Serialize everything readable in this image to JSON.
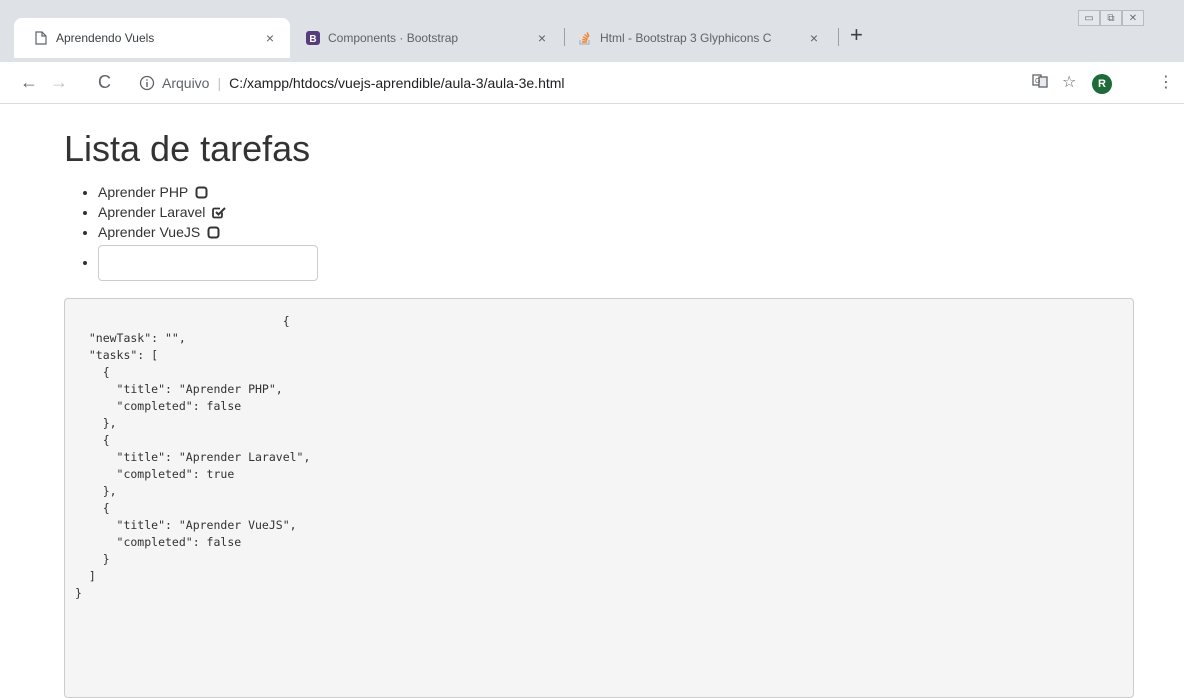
{
  "browser": {
    "tabs": [
      {
        "title": "Aprendendo Vuels",
        "close": "×"
      },
      {
        "title": "Components · Bootstrap",
        "close": "×"
      },
      {
        "title": "Html - Bootstrap 3 Glyphicons C",
        "close": "×"
      }
    ],
    "new_tab": "+",
    "omnibox": {
      "prefix": "Arquivo",
      "url": "C:/xampp/htdocs/vuejs-aprendible/aula-3/aula-3e.html"
    },
    "profile_initial": "R"
  },
  "page": {
    "title": "Lista de tarefas",
    "tasks": [
      {
        "title": "Aprender PHP",
        "completed": false
      },
      {
        "title": "Aprender Laravel",
        "completed": true
      },
      {
        "title": "Aprender VueJS",
        "completed": false
      }
    ],
    "new_task_value": "",
    "json_dump": "                              {\n  \"newTask\": \"\",\n  \"tasks\": [\n    {\n      \"title\": \"Aprender PHP\",\n      \"completed\": false\n    },\n    {\n      \"title\": \"Aprender Laravel\",\n      \"completed\": true\n    },\n    {\n      \"title\": \"Aprender VueJS\",\n      \"completed\": false\n    }\n  ]\n}"
  },
  "colors": {
    "tabstrip": "#dee1e6",
    "bootstrap_favicon": "#563d7c",
    "so_favicon": "#f48024",
    "avatar": "#1e6b3a",
    "pre_background": "#f5f5f5"
  }
}
